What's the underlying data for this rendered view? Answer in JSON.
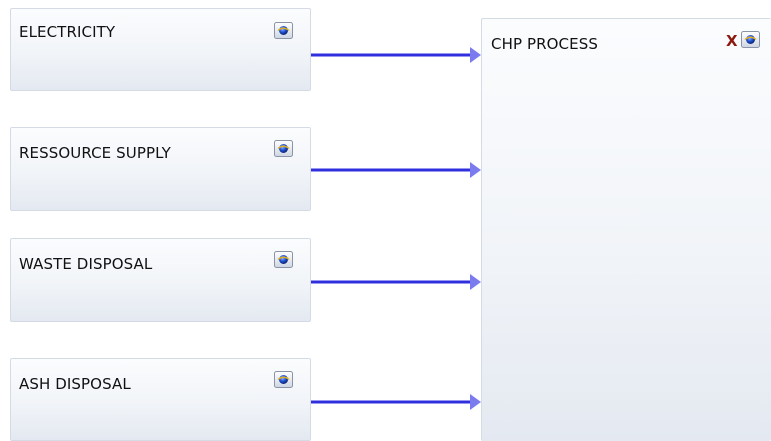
{
  "nodes": {
    "electricity": {
      "label": "ELECTRICITY",
      "icon": "window-icon"
    },
    "ressource_supply": {
      "label": "RESSOURCE SUPPLY",
      "icon": "window-icon"
    },
    "waste_disposal": {
      "label": "WASTE DISPOSAL",
      "icon": "window-icon"
    },
    "ash_disposal": {
      "label": "ASH DISPOSAL",
      "icon": "window-icon"
    },
    "chp_process": {
      "label": "CHP PROCESS",
      "close_label": "X",
      "icon": "window-icon"
    }
  },
  "colors": {
    "connector": "#2f2fe0",
    "arrowhead": "#7b7bf0",
    "close": "#8b1a10"
  }
}
